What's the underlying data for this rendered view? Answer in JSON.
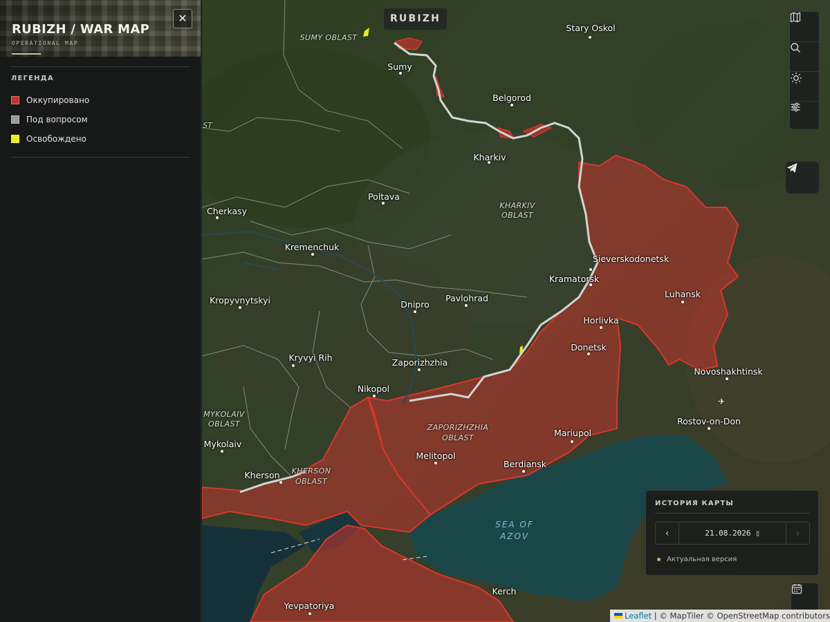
{
  "sidebar": {
    "title": "RUBIZH / WAR MAP",
    "subtitle": "OPERATIONAL MAP",
    "close_label": "✕",
    "legend_title": "ЛЕГЕНДА",
    "legend": [
      {
        "label": "Оккупировано",
        "color": "#c2342b"
      },
      {
        "label": "Под вопросом",
        "color": "#9a9a9a"
      },
      {
        "label": "Освобождено",
        "color": "#f2ea1a"
      }
    ]
  },
  "map": {
    "badge": "RUBIZH",
    "cities": {
      "stary_oskol": "Stary Oskol",
      "sumy": "Sumy",
      "belgorod": "Belgorod",
      "kharkiv": "Kharkiv",
      "poltava": "Poltava",
      "cherkasy": "Cherkasy",
      "kremenchuk": "Kremenchuk",
      "sievierodonetsk": "Sieverskodonetsk",
      "kramatorsk": "Kramatorsk",
      "luhansk": "Luhansk",
      "kropyvnytskyi": "Kropyvnytskyi",
      "dnipro": "Dnipro",
      "pavlohrad": "Pavlohrad",
      "horlivka": "Horlivka",
      "donetsk": "Donetsk",
      "kryvyi_rih": "Kryvyi Rih",
      "zaporizhzhia": "Zaporizhzhia",
      "novoshakhtinsk": "Novoshakhtinsk",
      "nikopol": "Nikopol",
      "rostov": "Rostov-on-Don",
      "mariupol": "Mariupol",
      "mykolaiv": "Mykolaiv",
      "melitopol": "Melitopol",
      "berdiansk": "Berdiansk",
      "kherson": "Kherson",
      "yevpatoriya": "Yevpatoriya",
      "kerch": "Kerch",
      "edge_st": "ST"
    },
    "regions": {
      "sumy_oblast": "SUMY OBLAST",
      "kharkiv_1": "KHARKIV",
      "kharkiv_2": "OBLAST",
      "mykolaiv_1": "MYKOLAIV",
      "mykolaiv_2": "OBLAST",
      "zaporizhzhia_1": "ZAPORIZHZHIA",
      "zaporizhzhia_2": "OBLAST",
      "kherson_1": "KHERSON",
      "kherson_2": "OBLAST"
    },
    "sea_1": "SEA OF",
    "sea_2": "AZOV",
    "colors": {
      "occupied": "#c2342b",
      "frontline": "#d9d9d9",
      "liberated": "#f2ea1a",
      "sea": "#163a40"
    }
  },
  "controls": {
    "icons": [
      "map-icon",
      "search-icon",
      "sun-icon",
      "sliders-icon"
    ],
    "telegram": "telegram-icon",
    "calendar": "calendar-icon"
  },
  "history": {
    "title": "ИСТОРИЯ КАРТЫ",
    "prev": "‹",
    "next": "›",
    "date": "21.08.2026 ▯",
    "status": "Актуальная версия"
  },
  "attribution": {
    "leaflet": "Leaflet",
    "rest": " | © MapTiler © OpenStreetMap contributors"
  }
}
